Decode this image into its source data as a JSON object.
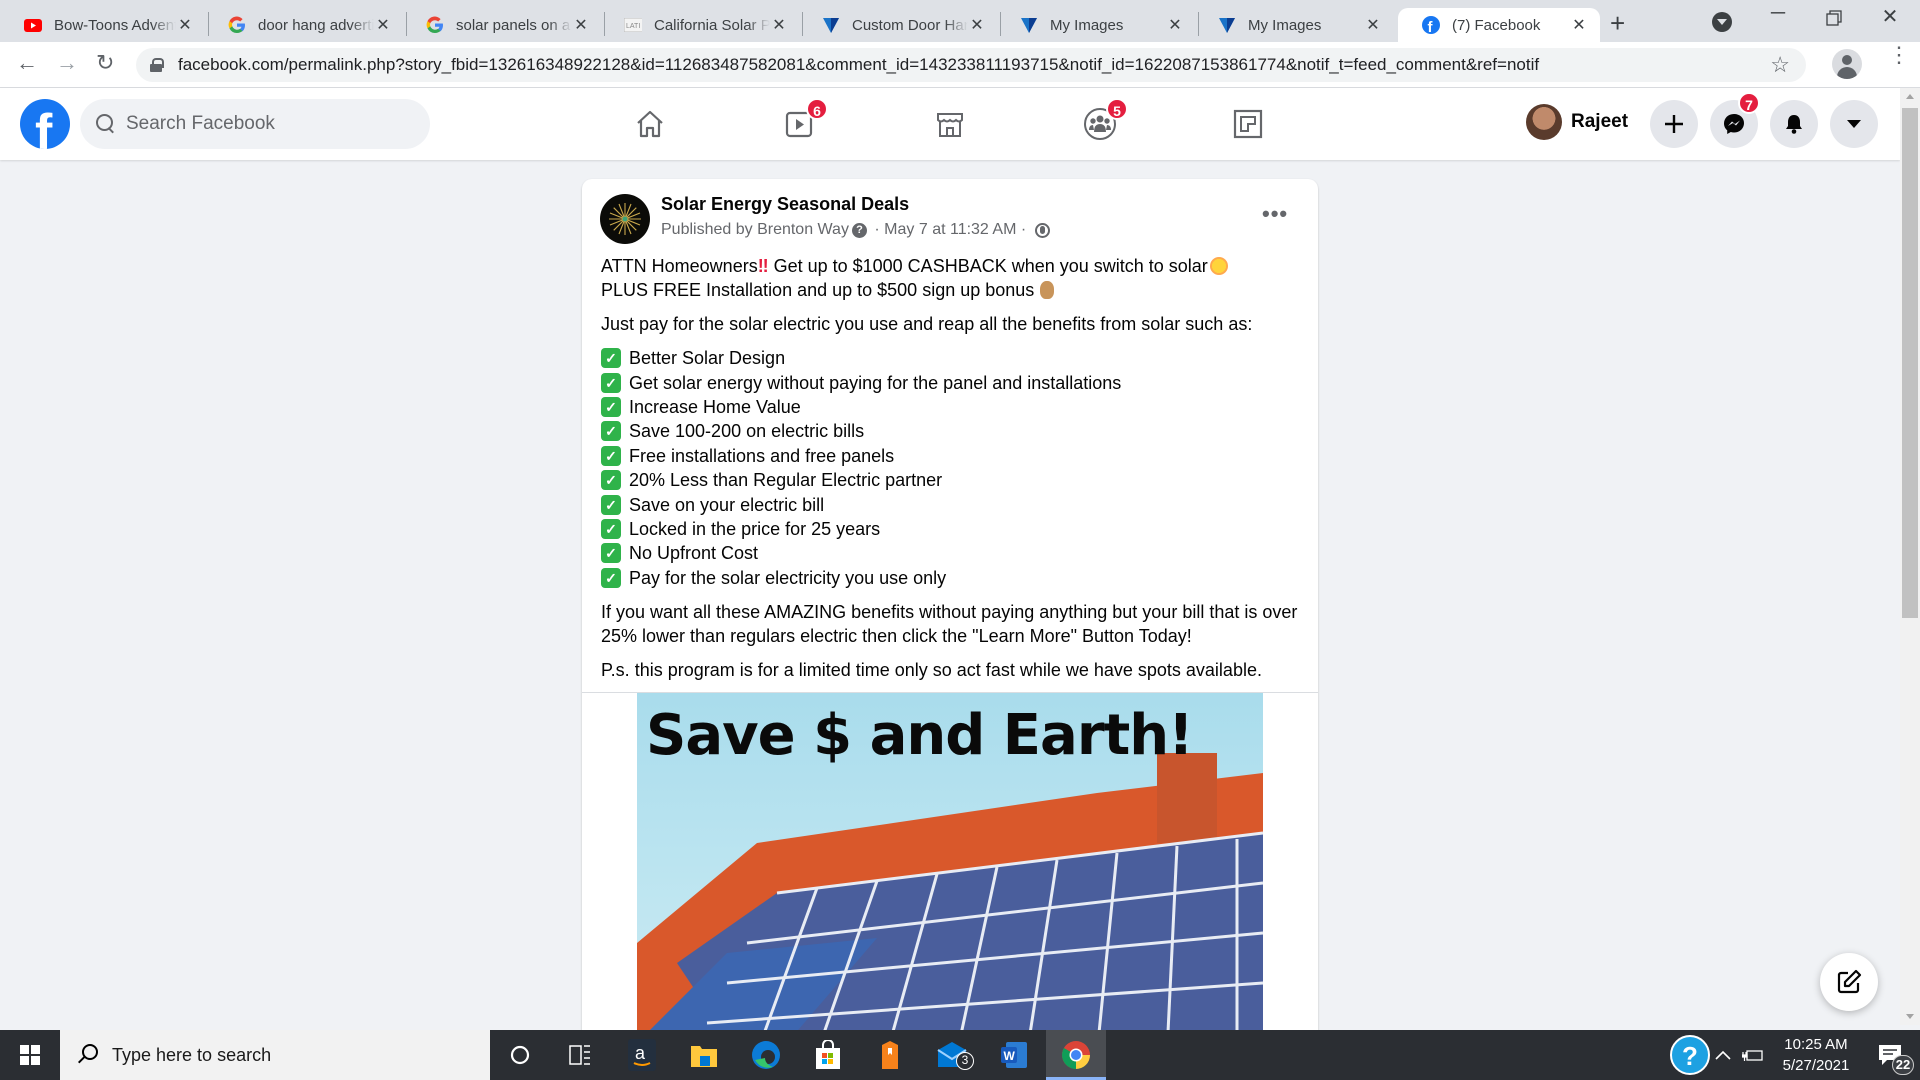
{
  "browser": {
    "tabs": [
      {
        "title": "Bow-Toons Adventures",
        "favicon": "youtube-icon",
        "active": false
      },
      {
        "title": "door hang advertising",
        "favicon": "google-icon",
        "active": false
      },
      {
        "title": "solar panels on a house",
        "favicon": "google-icon",
        "active": false
      },
      {
        "title": "California Solar Panels",
        "favicon": "latitude-icon",
        "active": false
      },
      {
        "title": "Custom Door Hangers",
        "favicon": "vistaprint-icon",
        "active": false
      },
      {
        "title": "My Images",
        "favicon": "vistaprint-icon",
        "active": false
      },
      {
        "title": "My Images",
        "favicon": "vistaprint-icon",
        "active": false
      },
      {
        "title": "(7) Facebook",
        "favicon": "facebook-icon",
        "active": true
      }
    ],
    "new_tab": "+",
    "url": "facebook.com/permalink.php?story_fbid=132616348922128&id=112683487582081&comment_id=143233811193715&notif_id=1622087153861774&notif_t=feed_comment&ref=notif"
  },
  "facebook": {
    "logo": "f",
    "search_placeholder": "Search Facebook",
    "nav": [
      {
        "name": "home",
        "badge": null
      },
      {
        "name": "watch",
        "badge": "6"
      },
      {
        "name": "marketplace",
        "badge": null
      },
      {
        "name": "groups",
        "badge": "5"
      },
      {
        "name": "gaming",
        "badge": null
      }
    ],
    "user": {
      "name": "Rajeet"
    },
    "actions": [
      {
        "name": "create",
        "badge": null
      },
      {
        "name": "messenger",
        "badge": "7"
      },
      {
        "name": "notifications",
        "badge": null
      },
      {
        "name": "account",
        "badge": null
      }
    ]
  },
  "post": {
    "page_name": "Solar Energy Seasonal Deals",
    "published_by": "Published by Brenton Way",
    "date": " · May 7 at 11:32 AM · ",
    "intro_a": "ATTN Homeowners",
    "intro_b": " Get up to $1000 CASHBACK when you switch to solar",
    "intro_c": "PLUS FREE Installation and up to $500 sign up bonus",
    "lead": "Just pay for the solar electric you use  and reap all the benefits from solar such as:",
    "benefits": [
      "Better Solar Design",
      "Get solar energy without paying for the panel and installations",
      "Increase Home Value",
      "Save 100-200 on electric bills",
      "Free installations and free panels",
      "20% Less than Regular Electric partner",
      "Save on your electric bill",
      "Locked in the price for 25 years",
      "No Upfront Cost",
      "Pay for the solar electricity you use only"
    ],
    "cta": "If you want all these AMAZING benefits without paying anything but your bill that is over 25% lower than regulars electric then click the \"Learn More\" Button Today!",
    "ps": "P.s. this program is for a limited time only so act fast while we have spots available.",
    "image_headline": "Save $ and Earth!"
  },
  "taskbar": {
    "search_placeholder": "Type here to search",
    "mail_badge": "3",
    "time": "10:25 AM",
    "date": "5/27/2021",
    "notifications_count": "22"
  },
  "colors": {
    "facebook_blue": "#1877f2",
    "badge_red": "#e41e3f",
    "check_green": "#2fb34a"
  }
}
